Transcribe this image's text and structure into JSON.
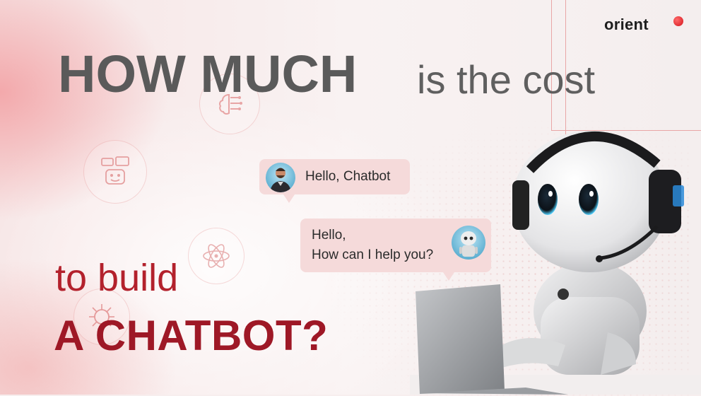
{
  "brand": {
    "name": "orient",
    "dot_color": "#d4141c"
  },
  "headline": {
    "line1_bold": "HOW MUCH",
    "line1_rest": "is the cost",
    "line2": "to build",
    "line3": "A CHATBOT?"
  },
  "chat": {
    "user_message": "Hello, Chatbot",
    "bot_message_line1": "Hello,",
    "bot_message_line2": "How can I help you?"
  },
  "decor_icons": [
    "brain-icon",
    "chatbot-face-icon",
    "atom-icon",
    "ai-chip-icon"
  ],
  "colors": {
    "headline_gray": "#5a5a5a",
    "accent_red": "#b3212c",
    "bubble": "#f5dada"
  }
}
